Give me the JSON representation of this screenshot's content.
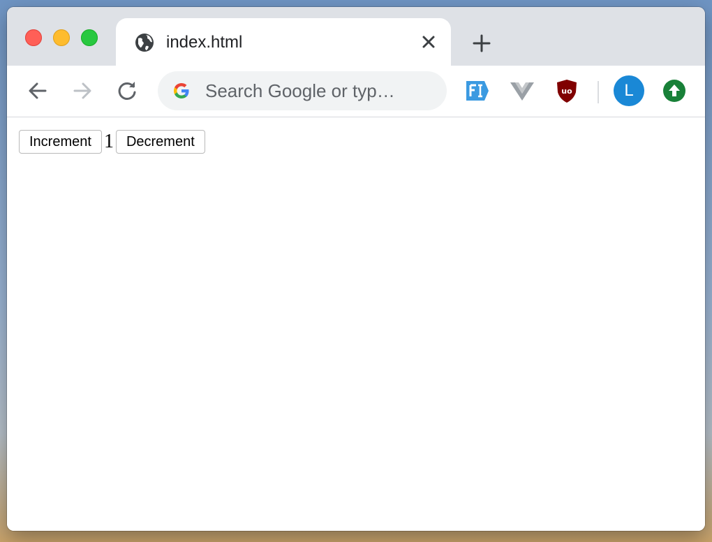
{
  "tab": {
    "title": "index.html",
    "icon": "globe-icon"
  },
  "omnibox": {
    "placeholder": "Search Google or typ…"
  },
  "profile": {
    "initial": "L"
  },
  "page": {
    "increment_label": "Increment",
    "count": "1",
    "decrement_label": "Decrement"
  },
  "colors": {
    "tabstrip": "#dee1e6",
    "avatar": "#1a88d6",
    "ublock": "#800000",
    "upload_ext": "#188038"
  }
}
